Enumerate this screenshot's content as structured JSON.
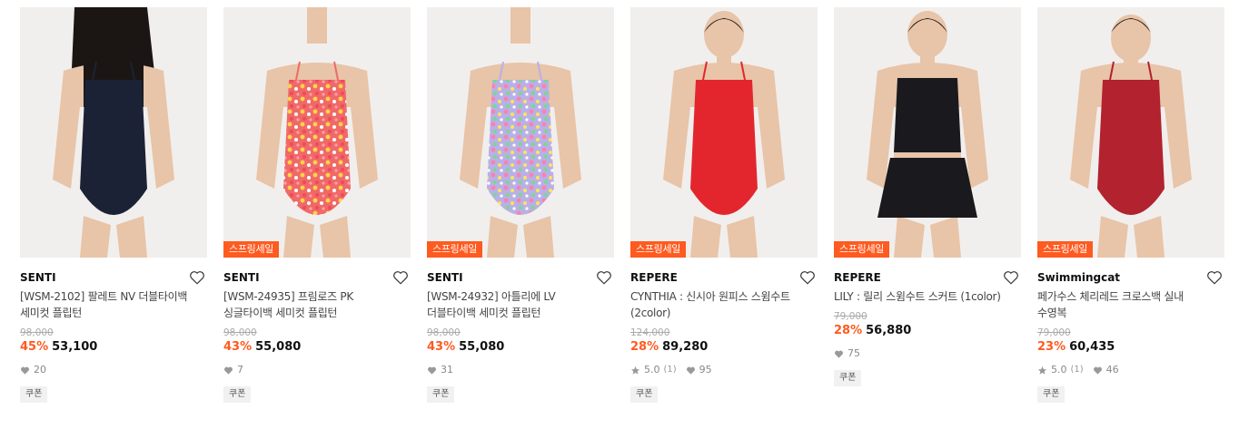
{
  "products": [
    {
      "brand": "SENTI",
      "name": "[WSM-2102] 팔레트 NV 더블타이백\n세미컷 플립턴",
      "badge": "",
      "original": "98,000",
      "discount": "45%",
      "price": "53,100",
      "rating": "",
      "reviews": "",
      "likes": "20",
      "coupon": "쿠폰",
      "suit_color": "#1c2236",
      "pattern": "solid"
    },
    {
      "brand": "SENTI",
      "name": "[WSM-24935] 프림로즈 PK\n싱글타이백 세미컷 플립턴",
      "badge": "스프링세일",
      "original": "98,000",
      "discount": "43%",
      "price": "55,080",
      "rating": "",
      "reviews": "",
      "likes": "7",
      "coupon": "쿠폰",
      "suit_color": "#ef6a67",
      "pattern": "floral-pink"
    },
    {
      "brand": "SENTI",
      "name": "[WSM-24932] 아틀리에 LV\n더블타이백 세미컷 플립턴",
      "badge": "스프링세일",
      "original": "98,000",
      "discount": "43%",
      "price": "55,080",
      "rating": "",
      "reviews": "",
      "likes": "31",
      "coupon": "쿠폰",
      "suit_color": "#b9b0e6",
      "pattern": "floral-lav"
    },
    {
      "brand": "REPERE",
      "name": "CYNTHIA : 신시아 원피스 스윔수트\n(2color)",
      "badge": "스프링세일",
      "original": "124,000",
      "discount": "28%",
      "price": "89,280",
      "rating": "5.0",
      "reviews": "(1)",
      "likes": "95",
      "coupon": "쿠폰",
      "suit_color": "#e3262e",
      "pattern": "solid"
    },
    {
      "brand": "REPERE",
      "name": "LILY : 릴리 스윔수트 스커트 (1color)",
      "badge": "스프링세일",
      "original": "79,000",
      "discount": "28%",
      "price": "56,880",
      "rating": "",
      "reviews": "",
      "likes": "75",
      "coupon": "쿠폰",
      "suit_color": "#1a1a1e",
      "pattern": "skirt"
    },
    {
      "brand": "Swimmingcat",
      "name": "페가수스 체리레드 크로스백 실내\n수영복",
      "badge": "스프링세일",
      "original": "79,000",
      "discount": "23%",
      "price": "60,435",
      "rating": "5.0",
      "reviews": "(1)",
      "likes": "46",
      "coupon": "쿠폰",
      "suit_color": "#b2222f",
      "pattern": "solid"
    }
  ],
  "colors": {
    "accent": "#ff5a1f",
    "badge_bg": "#ff5a1f"
  },
  "icons": {
    "like": "heart-outline-icon",
    "likes_count": "heart-filled-icon",
    "rating": "star-icon"
  }
}
